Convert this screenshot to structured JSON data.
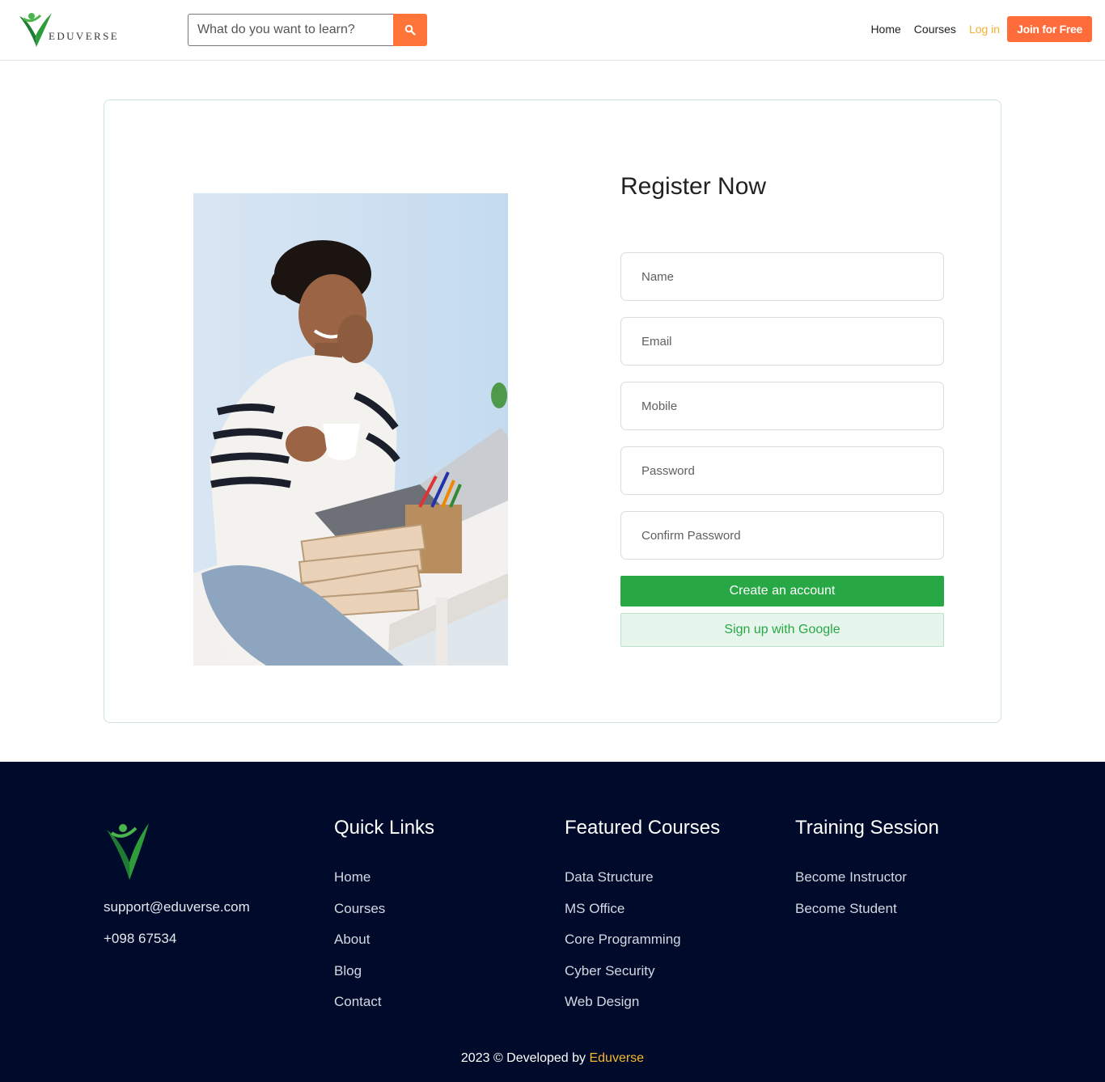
{
  "header": {
    "logo_text": "EDUVERSE",
    "search": {
      "placeholder": "What do you want to learn?"
    },
    "nav": {
      "home": "Home",
      "courses": "Courses",
      "login": "Log in",
      "join": "Join for Free"
    }
  },
  "register": {
    "title": "Register Now",
    "fields": {
      "name": "Name",
      "email": "Email",
      "mobile": "Mobile",
      "password": "Password",
      "confirm_password": "Confirm Password"
    },
    "create_button": "Create an account",
    "google_button": "Sign up with Google"
  },
  "footer": {
    "email": "support@eduverse.com",
    "phone": "+098 67534",
    "quick_links": {
      "title": "Quick Links",
      "items": [
        "Home",
        "Courses",
        "About",
        "Blog",
        "Contact"
      ]
    },
    "featured_courses": {
      "title": "Featured Courses",
      "items": [
        "Data Structure",
        "MS Office",
        "Core Programming",
        "Cyber Security",
        "Web Design"
      ]
    },
    "training_session": {
      "title": "Training Session",
      "items": [
        "Become Instructor",
        "Become Student"
      ]
    },
    "copyright_prefix": "2023 © Developed by",
    "copyright_brand": "Eduverse"
  },
  "colors": {
    "accent_orange": "#ff6c3b",
    "green": "#28a745",
    "login_yellow": "#f5b12c",
    "footer_bg": "#000a2a"
  },
  "icons": {
    "search_button": "search-icon"
  }
}
